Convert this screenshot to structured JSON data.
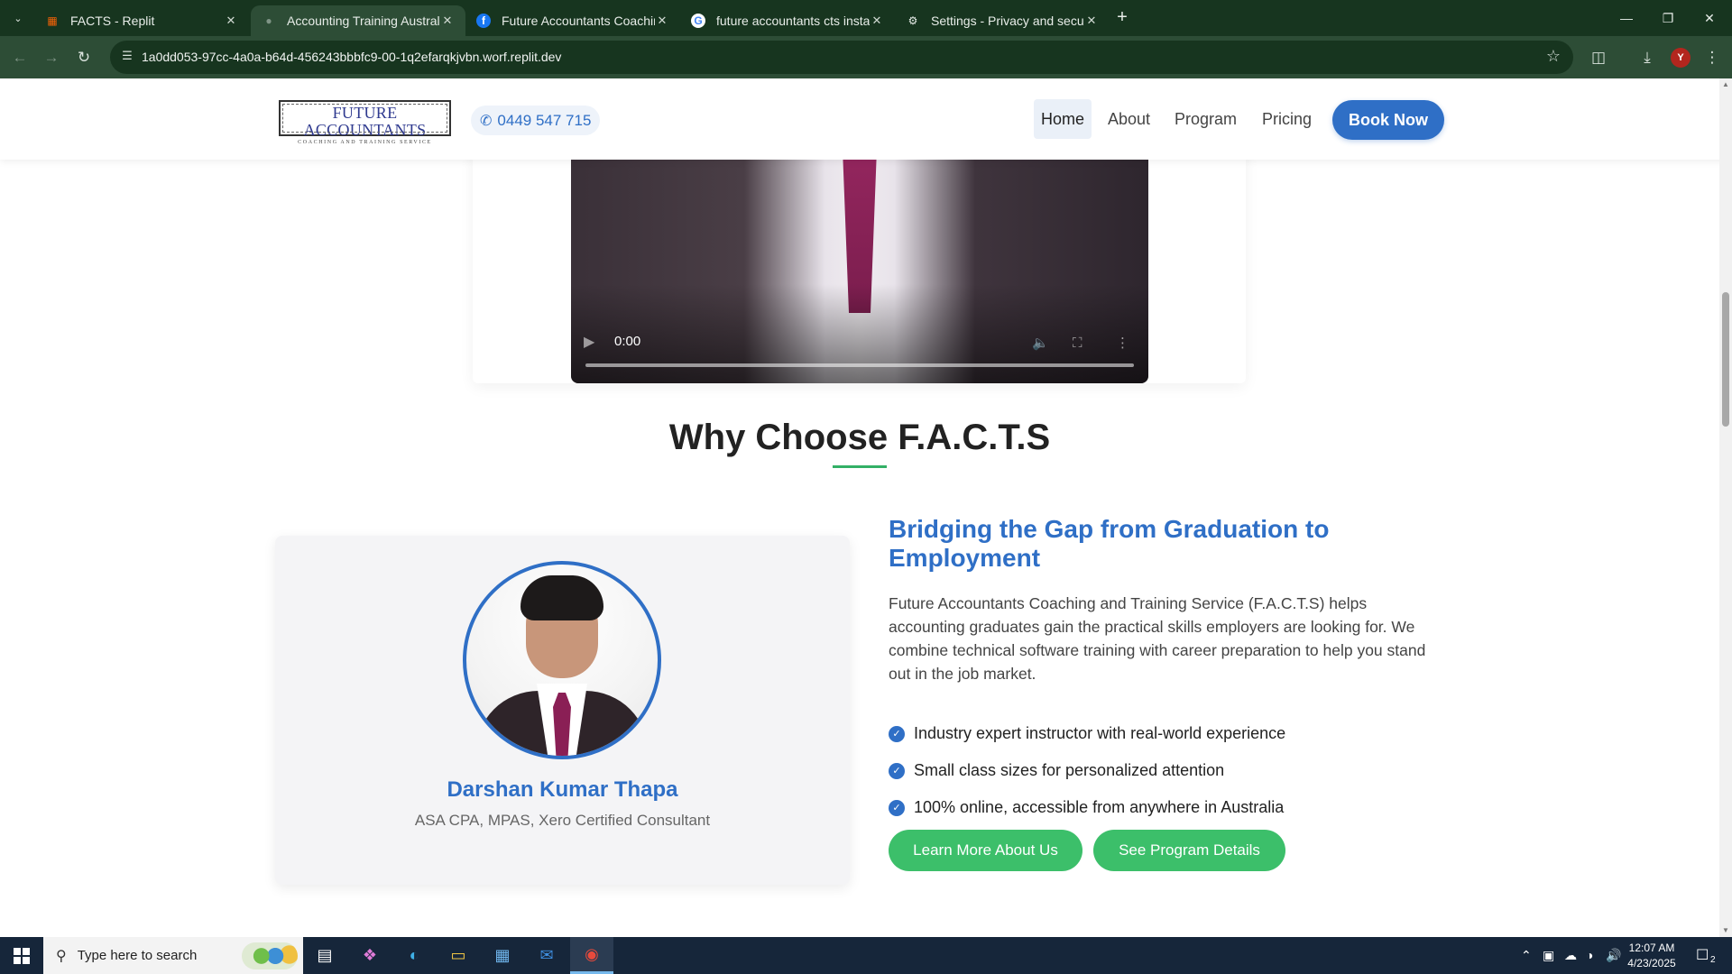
{
  "browser": {
    "tabs": [
      {
        "title": "FACTS - Replit",
        "favicon": "replit-icon",
        "active": false
      },
      {
        "title": "Accounting Training Australia |",
        "favicon": "globe-icon",
        "active": true
      },
      {
        "title": "Future Accountants Coaching &",
        "favicon": "facebook-icon",
        "active": false
      },
      {
        "title": "future accountants cts instagram",
        "favicon": "google-icon",
        "active": false
      },
      {
        "title": "Settings - Privacy and security",
        "favicon": "gear-icon",
        "active": false
      }
    ],
    "url": "1a0dd053-97cc-4a0a-b64d-456243bbbfc9-00-1q2efarqkjvbn.worf.replit.dev",
    "profile_initial": "Y"
  },
  "site": {
    "logo": {
      "line1": "FUTURE ACCOUNTANTS",
      "line2": "COACHING AND TRAINING SERVICE"
    },
    "phone": "0449 547 715",
    "nav": [
      "Home",
      "About",
      "Program",
      "Pricing"
    ],
    "active_nav": "Home",
    "book_now": "Book Now"
  },
  "video": {
    "time": "0:00"
  },
  "why": {
    "title": "Why Choose F.A.C.T.S",
    "instructor": {
      "name": "Darshan Kumar Thapa",
      "credentials": "ASA CPA, MPAS, Xero Certified Consultant"
    },
    "heading": "Bridging the Gap from Graduation to Employment",
    "paragraph": "Future Accountants Coaching and Training Service (F.A.C.T.S) helps accounting graduates gain the practical skills employers are looking for. We combine technical software training with career preparation to help you stand out in the job market.",
    "features": [
      "Industry expert instructor with real-world experience",
      "Small class sizes for personalized attention",
      "100% online, accessible from anywhere in Australia"
    ],
    "buttons": [
      "Learn More About Us",
      "See Program Details"
    ]
  },
  "taskbar": {
    "search_placeholder": "Type here to search",
    "time": "12:07 AM",
    "date": "4/23/2025",
    "notification_count": "2"
  },
  "colors": {
    "brand_blue": "#2f6fc6",
    "accent_green": "#3cbf6a",
    "chrome_dark": "#17351f",
    "chrome_toolbar": "#2d4d36"
  }
}
